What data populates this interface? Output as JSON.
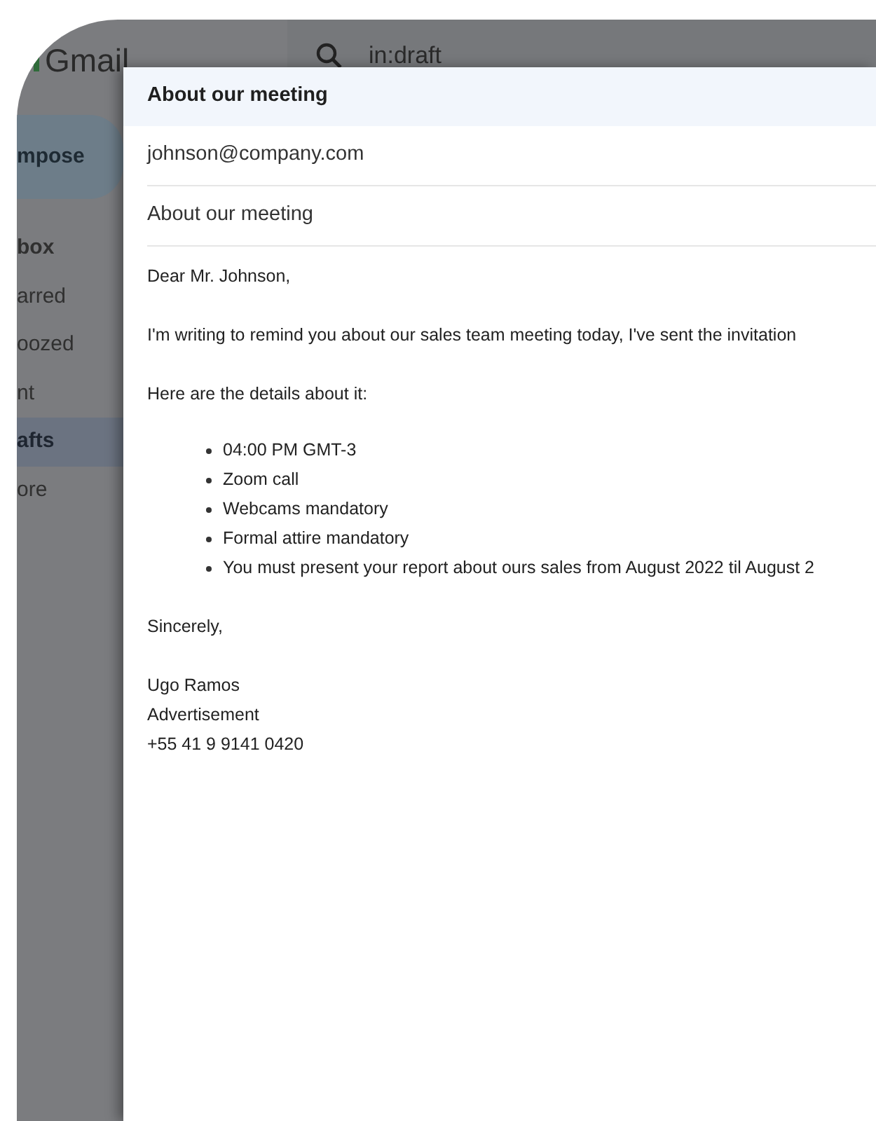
{
  "app": {
    "logo_text": "Gmail",
    "search": {
      "value": "in:draft"
    }
  },
  "sidebar": {
    "compose_label": "mpose",
    "items": [
      {
        "label": "box",
        "unread": true,
        "selected": false
      },
      {
        "label": "arred",
        "unread": false,
        "selected": false
      },
      {
        "label": "oozed",
        "unread": false,
        "selected": false
      },
      {
        "label": "nt",
        "unread": false,
        "selected": false
      },
      {
        "label": "afts",
        "unread": false,
        "selected": true
      },
      {
        "label": "ore",
        "unread": false,
        "selected": false
      }
    ]
  },
  "compose": {
    "title": "About our meeting",
    "to": "johnson@company.com",
    "subject": "About our meeting",
    "body": [
      {
        "kind": "paragraph",
        "lines": [
          "Dear Mr. Johnson,"
        ]
      },
      {
        "kind": "paragraph",
        "lines": [
          "I'm writing to remind you about our sales team meeting today, I've sent the invitation"
        ]
      },
      {
        "kind": "paragraph",
        "lines": [
          "Here are the details about it:"
        ]
      },
      {
        "kind": "list",
        "lines": [
          "04:00 PM GMT-3",
          "Zoom call",
          "Webcams mandatory",
          "Formal attire mandatory",
          "You must present your report about ours sales from August 2022 til August 2"
        ]
      },
      {
        "kind": "paragraph",
        "lines": [
          "Sincerely,"
        ]
      },
      {
        "kind": "paragraph",
        "lines": [
          "Ugo Ramos",
          "Advertisement",
          "+55 41 9 9141 0420"
        ]
      }
    ]
  }
}
